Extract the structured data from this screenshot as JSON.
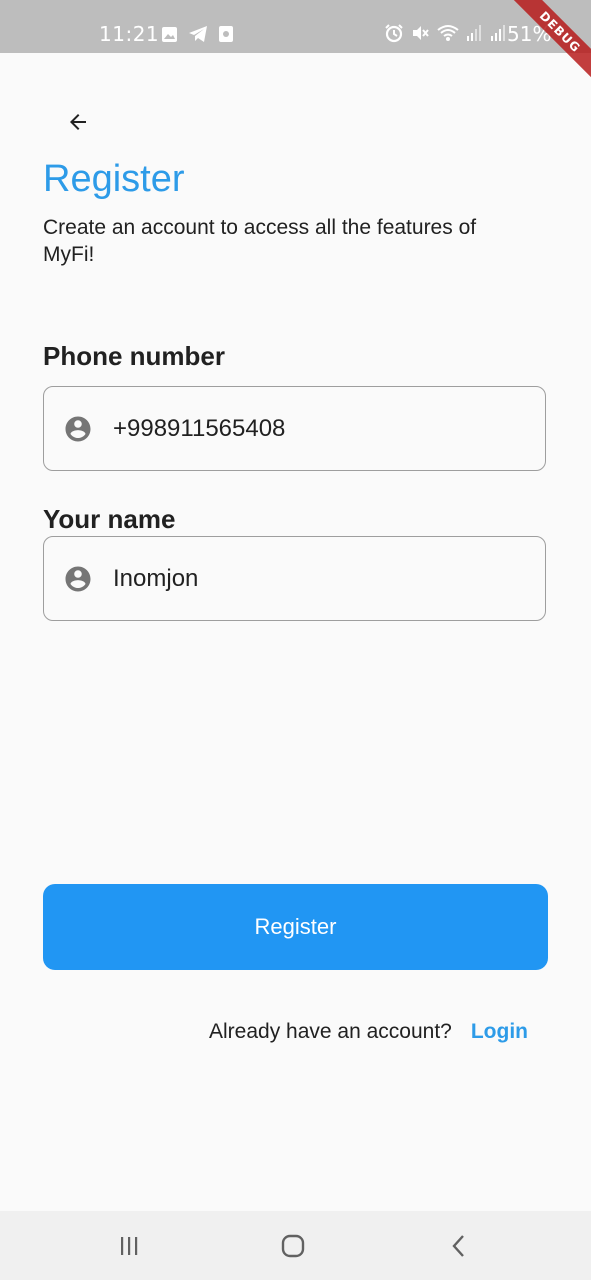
{
  "status_bar": {
    "time": "11:21",
    "battery": "51%",
    "left_icons": [
      "image-icon",
      "telegram-icon",
      "app-notification-icon"
    ],
    "right_icons": [
      "alarm-icon",
      "mute-icon",
      "wifi-icon",
      "signal-icon",
      "signal-icon",
      "battery-icon"
    ]
  },
  "debug_banner": "DEBUG",
  "header": {
    "back_icon": "arrow-left-icon",
    "title": "Register",
    "subtitle": "Create an account to access all the features of MyFi!"
  },
  "form": {
    "phone": {
      "label": "Phone number",
      "value": "+998911565408",
      "icon": "account-circle-icon"
    },
    "name": {
      "label": "Your name",
      "value": "Inomjon",
      "icon": "account-circle-icon"
    },
    "submit_label": "Register"
  },
  "footer": {
    "prompt": "Already have an account?",
    "login_label": "Login"
  },
  "nav_bar": {
    "buttons": [
      "recents-icon",
      "home-icon",
      "back-icon"
    ]
  },
  "colors": {
    "accent": "#2d9be8",
    "button": "#2196f3",
    "status_bar": "#bdbdbd",
    "background": "#fafafa"
  }
}
